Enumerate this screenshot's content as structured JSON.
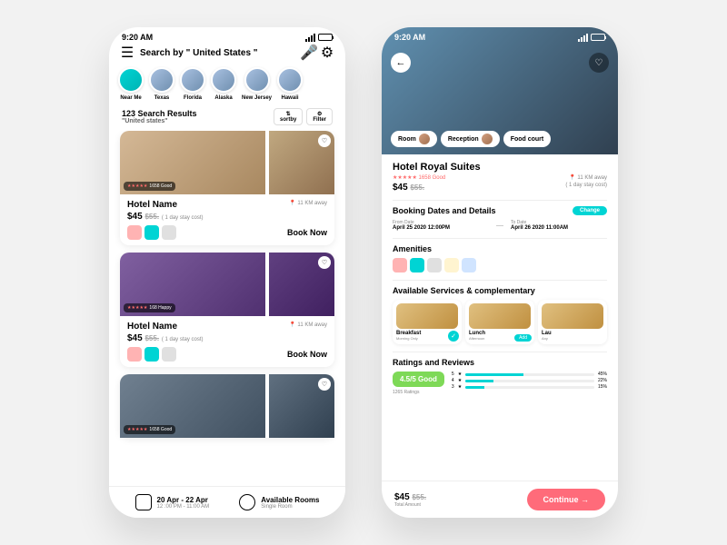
{
  "status_time": "9:20 AM",
  "search": {
    "placeholder": "Search by \" United States \""
  },
  "categories": [
    {
      "label": "Near Me"
    },
    {
      "label": "Texas"
    },
    {
      "label": "Florida"
    },
    {
      "label": "Alaska"
    },
    {
      "label": "New Jersey"
    },
    {
      "label": "Hawaii"
    }
  ],
  "results": {
    "count": "123 Search Results",
    "query": "\"United states\""
  },
  "sort": "sortby",
  "filter": "Filter",
  "cards": [
    {
      "badge": "1658 Good",
      "title": "Hotel Name",
      "dist": "11 KM away",
      "price": "$45",
      "old": "$55.",
      "note": "( 1 day stay cost)",
      "book": "Book Now"
    },
    {
      "badge": "168 Happy",
      "title": "Hotel Name",
      "dist": "11 KM away",
      "price": "$45",
      "old": "$55.",
      "note": "( 1 day stay cost)",
      "book": "Book Now"
    },
    {
      "badge": "1658 Good"
    }
  ],
  "bottom": {
    "dates": "20 Apr - 22 Apr",
    "times": "12 :00 PM - 11:00 AM",
    "rooms": "Available Rooms",
    "room_type": "Single Room"
  },
  "detail": {
    "chips": [
      "Room",
      "Reception",
      "Food court"
    ],
    "name": "Hotel Royal Suites",
    "rating": "★★★★★ 1658 Good",
    "dist": "11 KM away",
    "price": "$45",
    "old": "$55.",
    "note": "( 1 day stay cost)",
    "booking_h": "Booking Dates and Details",
    "change": "Change",
    "from_lbl": "From Date",
    "from_val": "April 25 2020   12:00PM",
    "to_lbl": "To  Date",
    "to_val": "April 26 2020   11:00AM",
    "amenities_h": "Amenities",
    "services_h": "Available Services & complementary",
    "svcs": [
      {
        "name": "Breakfast",
        "sub": "Morning Only",
        "done": true
      },
      {
        "name": "Lunch",
        "sub": "Afternoon",
        "btn": "Add"
      },
      {
        "name": "Lau",
        "sub": "Any"
      }
    ],
    "ratings_h": "Ratings and Reviews",
    "rate_badge": "4.5/5 Good",
    "rate_count": "1265 Ratings",
    "bars": [
      {
        "n": "5",
        "p": 45,
        "t": "45%"
      },
      {
        "n": "4",
        "p": 22,
        "t": "22%"
      },
      {
        "n": "3",
        "p": 15,
        "t": "15%"
      }
    ],
    "total": "$45",
    "total_old": "$55.",
    "total_lbl": "Total Amount",
    "continue": "Continue →"
  }
}
